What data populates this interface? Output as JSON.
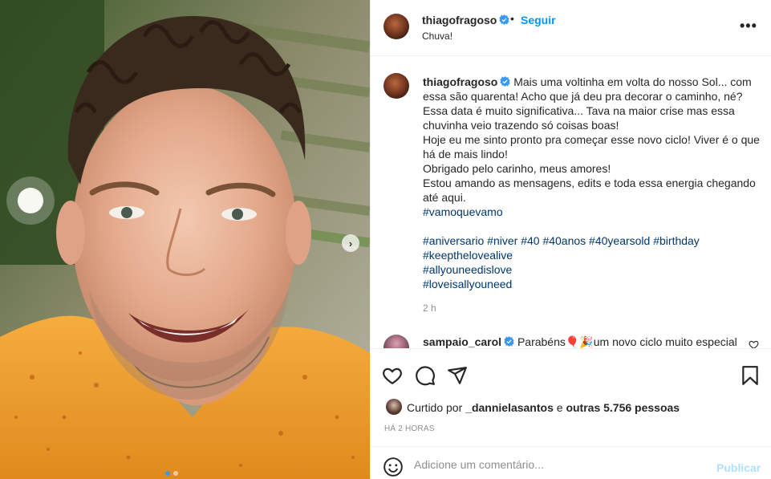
{
  "post": {
    "username": "thiagofragoso",
    "separator": "•",
    "follow_label": "Seguir",
    "location": "Chuva!",
    "more_label": "•••"
  },
  "caption": {
    "username": "thiagofragoso",
    "lines": [
      "Mais uma voltinha em volta do nosso Sol... com",
      "essa são quarenta! Acho que já deu pra decorar o caminho, né?",
      "Essa data é muito significativa... Tava na maior crise mas essa",
      "chuvinha veio trazendo só coisas boas!",
      "Hoje eu me sinto pronto pra começar esse novo ciclo! Viver é o que",
      "há de mais lindo!",
      "Obrigado pelo carinho, meus amores!",
      "Estou amando as mensagens, edits e toda essa energia chegando",
      "até aqui."
    ],
    "hashtag_main": "#vamoquevamo",
    "hashtags_row": [
      "#aniversario",
      "#niver",
      "#40",
      "#40anos",
      "#40yearsold",
      "#birthday"
    ],
    "hashtags_extra": [
      "#keepthelovealive",
      "#allyouneedislove",
      "#loveisallyouneed"
    ],
    "time": "2 h"
  },
  "comment": {
    "username": "sampaio_carol",
    "text_before": "Parabéns",
    "emoji": "🎈🎉",
    "text_after": "um novo ciclo muito especial"
  },
  "likes": {
    "prefix": "Curtido por",
    "user": "_dannielasantos",
    "middle": "e",
    "others": "outras 5.756 pessoas"
  },
  "timestamp": "HÁ 2 HORAS",
  "add_comment": {
    "placeholder": "Adicione um comentário...",
    "publish_label": "Publicar"
  },
  "carousel": {
    "next_label": "›",
    "slide_count": 2,
    "active_slide": 1
  },
  "colors": {
    "accent": "#0095f6",
    "hashtag": "#00376b",
    "muted": "#8e8e8e",
    "publish_disabled": "#b2dffc",
    "shirt": "#f2a535"
  },
  "icons": [
    "verified-badge-icon",
    "heart-icon",
    "comment-icon",
    "share-icon",
    "bookmark-icon",
    "emoji-icon",
    "chevron-right-icon"
  ]
}
